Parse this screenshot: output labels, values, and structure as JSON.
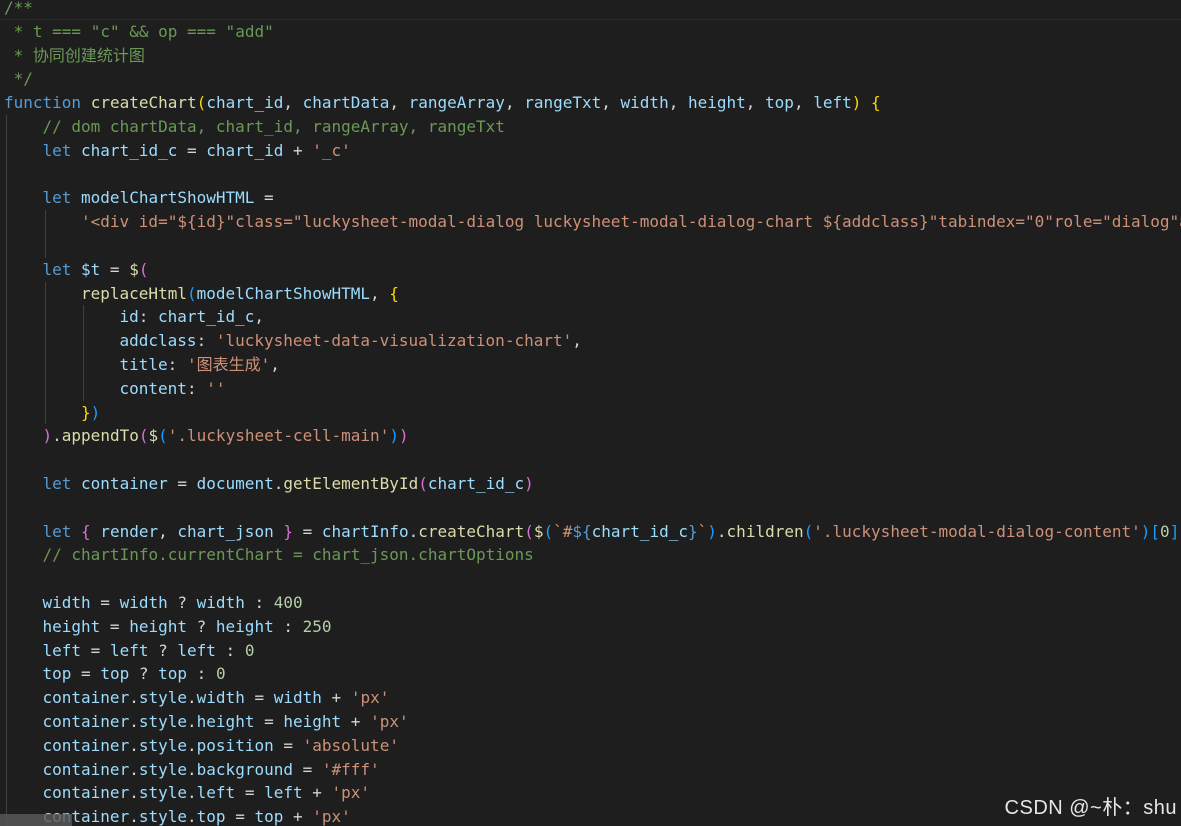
{
  "editor": {
    "lines": [
      {
        "indent": 0,
        "tokens": [
          {
            "t": "/**",
            "c": "c-com"
          }
        ]
      },
      {
        "indent": 0,
        "tokens": [
          {
            "t": " * t === \"c\" && op === \"add\"",
            "c": "c-com"
          }
        ]
      },
      {
        "indent": 0,
        "tokens": [
          {
            "t": " * 协同创建统计图",
            "c": "c-com"
          }
        ]
      },
      {
        "indent": 0,
        "tokens": [
          {
            "t": " */",
            "c": "c-com"
          }
        ]
      },
      {
        "indent": 0,
        "tokens": [
          {
            "t": "function ",
            "c": "c-kw"
          },
          {
            "t": "createChart",
            "c": "c-fn"
          },
          {
            "t": "(",
            "c": "c-y"
          },
          {
            "t": "chart_id",
            "c": "c-var"
          },
          {
            "t": ", ",
            "c": "c-op"
          },
          {
            "t": "chartData",
            "c": "c-var"
          },
          {
            "t": ", ",
            "c": "c-op"
          },
          {
            "t": "rangeArray",
            "c": "c-var"
          },
          {
            "t": ", ",
            "c": "c-op"
          },
          {
            "t": "rangeTxt",
            "c": "c-var"
          },
          {
            "t": ", ",
            "c": "c-op"
          },
          {
            "t": "width",
            "c": "c-var"
          },
          {
            "t": ", ",
            "c": "c-op"
          },
          {
            "t": "height",
            "c": "c-var"
          },
          {
            "t": ", ",
            "c": "c-op"
          },
          {
            "t": "top",
            "c": "c-var"
          },
          {
            "t": ", ",
            "c": "c-op"
          },
          {
            "t": "left",
            "c": "c-var"
          },
          {
            "t": ")",
            "c": "c-y"
          },
          {
            "t": " ",
            "c": "c-op"
          },
          {
            "t": "{",
            "c": "c-y"
          }
        ]
      },
      {
        "indent": 1,
        "tokens": [
          {
            "t": "// dom chartData, chart_id, rangeArray, rangeTxt",
            "c": "c-com"
          }
        ]
      },
      {
        "indent": 1,
        "tokens": [
          {
            "t": "let ",
            "c": "c-kw"
          },
          {
            "t": "chart_id_c",
            "c": "c-var"
          },
          {
            "t": " = ",
            "c": "c-op"
          },
          {
            "t": "chart_id",
            "c": "c-var"
          },
          {
            "t": " + ",
            "c": "c-op"
          },
          {
            "t": "'_c'",
            "c": "c-str"
          }
        ]
      },
      {
        "indent": 0,
        "tokens": []
      },
      {
        "indent": 1,
        "tokens": [
          {
            "t": "let ",
            "c": "c-kw"
          },
          {
            "t": "modelChartShowHTML",
            "c": "c-var"
          },
          {
            "t": " =",
            "c": "c-op"
          }
        ]
      },
      {
        "indent": 2,
        "tokens": [
          {
            "t": "'<div id=\"${id}\"class=\"luckysheet-modal-dialog luckysheet-modal-dialog-chart ${addclass}\"tabindex=\"0\"role=\"dialog\"aria",
            "c": "c-str"
          }
        ]
      },
      {
        "indent": 0,
        "tokens": []
      },
      {
        "indent": 1,
        "tokens": [
          {
            "t": "let ",
            "c": "c-kw"
          },
          {
            "t": "$t",
            "c": "c-var"
          },
          {
            "t": " = ",
            "c": "c-op"
          },
          {
            "t": "$",
            "c": "c-fn"
          },
          {
            "t": "(",
            "c": "c-p"
          }
        ]
      },
      {
        "indent": 2,
        "tokens": [
          {
            "t": "replaceHtml",
            "c": "c-fn"
          },
          {
            "t": "(",
            "c": "c-b"
          },
          {
            "t": "modelChartShowHTML",
            "c": "c-var"
          },
          {
            "t": ", ",
            "c": "c-op"
          },
          {
            "t": "{",
            "c": "c-y"
          }
        ]
      },
      {
        "indent": 3,
        "tokens": [
          {
            "t": "id",
            "c": "c-var"
          },
          {
            "t": ": ",
            "c": "c-op"
          },
          {
            "t": "chart_id_c",
            "c": "c-var"
          },
          {
            "t": ",",
            "c": "c-op"
          }
        ]
      },
      {
        "indent": 3,
        "tokens": [
          {
            "t": "addclass",
            "c": "c-var"
          },
          {
            "t": ": ",
            "c": "c-op"
          },
          {
            "t": "'luckysheet-data-visualization-chart'",
            "c": "c-str"
          },
          {
            "t": ",",
            "c": "c-op"
          }
        ]
      },
      {
        "indent": 3,
        "tokens": [
          {
            "t": "title",
            "c": "c-var"
          },
          {
            "t": ": ",
            "c": "c-op"
          },
          {
            "t": "'图表生成'",
            "c": "c-str"
          },
          {
            "t": ",",
            "c": "c-op"
          }
        ]
      },
      {
        "indent": 3,
        "tokens": [
          {
            "t": "content",
            "c": "c-var"
          },
          {
            "t": ": ",
            "c": "c-op"
          },
          {
            "t": "''",
            "c": "c-str"
          }
        ]
      },
      {
        "indent": 2,
        "tokens": [
          {
            "t": "}",
            "c": "c-y"
          },
          {
            "t": ")",
            "c": "c-b"
          }
        ]
      },
      {
        "indent": 1,
        "tokens": [
          {
            "t": ")",
            "c": "c-p"
          },
          {
            "t": ".",
            "c": "c-op"
          },
          {
            "t": "appendTo",
            "c": "c-fn"
          },
          {
            "t": "(",
            "c": "c-p"
          },
          {
            "t": "$",
            "c": "c-fn"
          },
          {
            "t": "(",
            "c": "c-b"
          },
          {
            "t": "'.luckysheet-cell-main'",
            "c": "c-str"
          },
          {
            "t": ")",
            "c": "c-b"
          },
          {
            "t": ")",
            "c": "c-p"
          }
        ]
      },
      {
        "indent": 0,
        "tokens": []
      },
      {
        "indent": 1,
        "tokens": [
          {
            "t": "let ",
            "c": "c-kw"
          },
          {
            "t": "container",
            "c": "c-var"
          },
          {
            "t": " = ",
            "c": "c-op"
          },
          {
            "t": "document",
            "c": "c-var"
          },
          {
            "t": ".",
            "c": "c-op"
          },
          {
            "t": "getElementById",
            "c": "c-fn"
          },
          {
            "t": "(",
            "c": "c-p"
          },
          {
            "t": "chart_id_c",
            "c": "c-var"
          },
          {
            "t": ")",
            "c": "c-p"
          }
        ]
      },
      {
        "indent": 0,
        "tokens": []
      },
      {
        "indent": 1,
        "tokens": [
          {
            "t": "let ",
            "c": "c-kw"
          },
          {
            "t": "{",
            "c": "c-p"
          },
          {
            "t": " render",
            "c": "c-var"
          },
          {
            "t": ", ",
            "c": "c-op"
          },
          {
            "t": "chart_json",
            "c": "c-var"
          },
          {
            "t": " ",
            "c": "c-op"
          },
          {
            "t": "}",
            "c": "c-p"
          },
          {
            "t": " = ",
            "c": "c-op"
          },
          {
            "t": "chartInfo",
            "c": "c-var"
          },
          {
            "t": ".",
            "c": "c-op"
          },
          {
            "t": "createChart",
            "c": "c-fn"
          },
          {
            "t": "(",
            "c": "c-p"
          },
          {
            "t": "$",
            "c": "c-fn"
          },
          {
            "t": "(",
            "c": "c-b"
          },
          {
            "t": "`#",
            "c": "c-str"
          },
          {
            "t": "${",
            "c": "c-kw"
          },
          {
            "t": "chart_id_c",
            "c": "c-var"
          },
          {
            "t": "}",
            "c": "c-kw"
          },
          {
            "t": "`",
            "c": "c-str"
          },
          {
            "t": ")",
            "c": "c-b"
          },
          {
            "t": ".",
            "c": "c-op"
          },
          {
            "t": "children",
            "c": "c-fn"
          },
          {
            "t": "(",
            "c": "c-b"
          },
          {
            "t": "'.luckysheet-modal-dialog-content'",
            "c": "c-str"
          },
          {
            "t": ")",
            "c": "c-b"
          },
          {
            "t": "[",
            "c": "c-b"
          },
          {
            "t": "0",
            "c": "c-num"
          },
          {
            "t": "],",
            "c": "c-b"
          }
        ]
      },
      {
        "indent": 1,
        "tokens": [
          {
            "t": "// chartInfo.currentChart = chart_json.chartOptions",
            "c": "c-com"
          }
        ]
      },
      {
        "indent": 0,
        "tokens": []
      },
      {
        "indent": 1,
        "tokens": [
          {
            "t": "width",
            "c": "c-var"
          },
          {
            "t": " = ",
            "c": "c-op"
          },
          {
            "t": "width",
            "c": "c-var"
          },
          {
            "t": " ? ",
            "c": "c-op"
          },
          {
            "t": "width",
            "c": "c-var"
          },
          {
            "t": " : ",
            "c": "c-op"
          },
          {
            "t": "400",
            "c": "c-num"
          }
        ]
      },
      {
        "indent": 1,
        "tokens": [
          {
            "t": "height",
            "c": "c-var"
          },
          {
            "t": " = ",
            "c": "c-op"
          },
          {
            "t": "height",
            "c": "c-var"
          },
          {
            "t": " ? ",
            "c": "c-op"
          },
          {
            "t": "height",
            "c": "c-var"
          },
          {
            "t": " : ",
            "c": "c-op"
          },
          {
            "t": "250",
            "c": "c-num"
          }
        ]
      },
      {
        "indent": 1,
        "tokens": [
          {
            "t": "left",
            "c": "c-var"
          },
          {
            "t": " = ",
            "c": "c-op"
          },
          {
            "t": "left",
            "c": "c-var"
          },
          {
            "t": " ? ",
            "c": "c-op"
          },
          {
            "t": "left",
            "c": "c-var"
          },
          {
            "t": " : ",
            "c": "c-op"
          },
          {
            "t": "0",
            "c": "c-num"
          }
        ]
      },
      {
        "indent": 1,
        "tokens": [
          {
            "t": "top",
            "c": "c-var"
          },
          {
            "t": " = ",
            "c": "c-op"
          },
          {
            "t": "top",
            "c": "c-var"
          },
          {
            "t": " ? ",
            "c": "c-op"
          },
          {
            "t": "top",
            "c": "c-var"
          },
          {
            "t": " : ",
            "c": "c-op"
          },
          {
            "t": "0",
            "c": "c-num"
          }
        ]
      },
      {
        "indent": 1,
        "tokens": [
          {
            "t": "container",
            "c": "c-var"
          },
          {
            "t": ".",
            "c": "c-op"
          },
          {
            "t": "style",
            "c": "c-var"
          },
          {
            "t": ".",
            "c": "c-op"
          },
          {
            "t": "width",
            "c": "c-var"
          },
          {
            "t": " = ",
            "c": "c-op"
          },
          {
            "t": "width",
            "c": "c-var"
          },
          {
            "t": " + ",
            "c": "c-op"
          },
          {
            "t": "'px'",
            "c": "c-str"
          }
        ]
      },
      {
        "indent": 1,
        "tokens": [
          {
            "t": "container",
            "c": "c-var"
          },
          {
            "t": ".",
            "c": "c-op"
          },
          {
            "t": "style",
            "c": "c-var"
          },
          {
            "t": ".",
            "c": "c-op"
          },
          {
            "t": "height",
            "c": "c-var"
          },
          {
            "t": " = ",
            "c": "c-op"
          },
          {
            "t": "height",
            "c": "c-var"
          },
          {
            "t": " + ",
            "c": "c-op"
          },
          {
            "t": "'px'",
            "c": "c-str"
          }
        ]
      },
      {
        "indent": 1,
        "tokens": [
          {
            "t": "container",
            "c": "c-var"
          },
          {
            "t": ".",
            "c": "c-op"
          },
          {
            "t": "style",
            "c": "c-var"
          },
          {
            "t": ".",
            "c": "c-op"
          },
          {
            "t": "position",
            "c": "c-var"
          },
          {
            "t": " = ",
            "c": "c-op"
          },
          {
            "t": "'absolute'",
            "c": "c-str"
          }
        ]
      },
      {
        "indent": 1,
        "tokens": [
          {
            "t": "container",
            "c": "c-var"
          },
          {
            "t": ".",
            "c": "c-op"
          },
          {
            "t": "style",
            "c": "c-var"
          },
          {
            "t": ".",
            "c": "c-op"
          },
          {
            "t": "background",
            "c": "c-var"
          },
          {
            "t": " = ",
            "c": "c-op"
          },
          {
            "t": "'#fff'",
            "c": "c-str"
          }
        ]
      },
      {
        "indent": 1,
        "tokens": [
          {
            "t": "container",
            "c": "c-var"
          },
          {
            "t": ".",
            "c": "c-op"
          },
          {
            "t": "style",
            "c": "c-var"
          },
          {
            "t": ".",
            "c": "c-op"
          },
          {
            "t": "left",
            "c": "c-var"
          },
          {
            "t": " = ",
            "c": "c-op"
          },
          {
            "t": "left",
            "c": "c-var"
          },
          {
            "t": " + ",
            "c": "c-op"
          },
          {
            "t": "'px'",
            "c": "c-str"
          }
        ]
      },
      {
        "indent": 1,
        "tokens": [
          {
            "t": "container",
            "c": "c-var"
          },
          {
            "t": ".",
            "c": "c-op"
          },
          {
            "t": "style",
            "c": "c-var"
          },
          {
            "t": ".",
            "c": "c-op"
          },
          {
            "t": "top",
            "c": "c-var"
          },
          {
            "t": " = ",
            "c": "c-op"
          },
          {
            "t": "top",
            "c": "c-var"
          },
          {
            "t": " + ",
            "c": "c-op"
          },
          {
            "t": "'px'",
            "c": "c-str"
          }
        ]
      }
    ]
  },
  "watermark": "CSDN @~朴：shu",
  "colors": {
    "background": "#1e1e1e",
    "comment": "#6a9955",
    "keyword": "#569cd6",
    "function": "#dcdcaa",
    "variable": "#9cdcfe",
    "string": "#ce9178",
    "number": "#b5cea8"
  }
}
